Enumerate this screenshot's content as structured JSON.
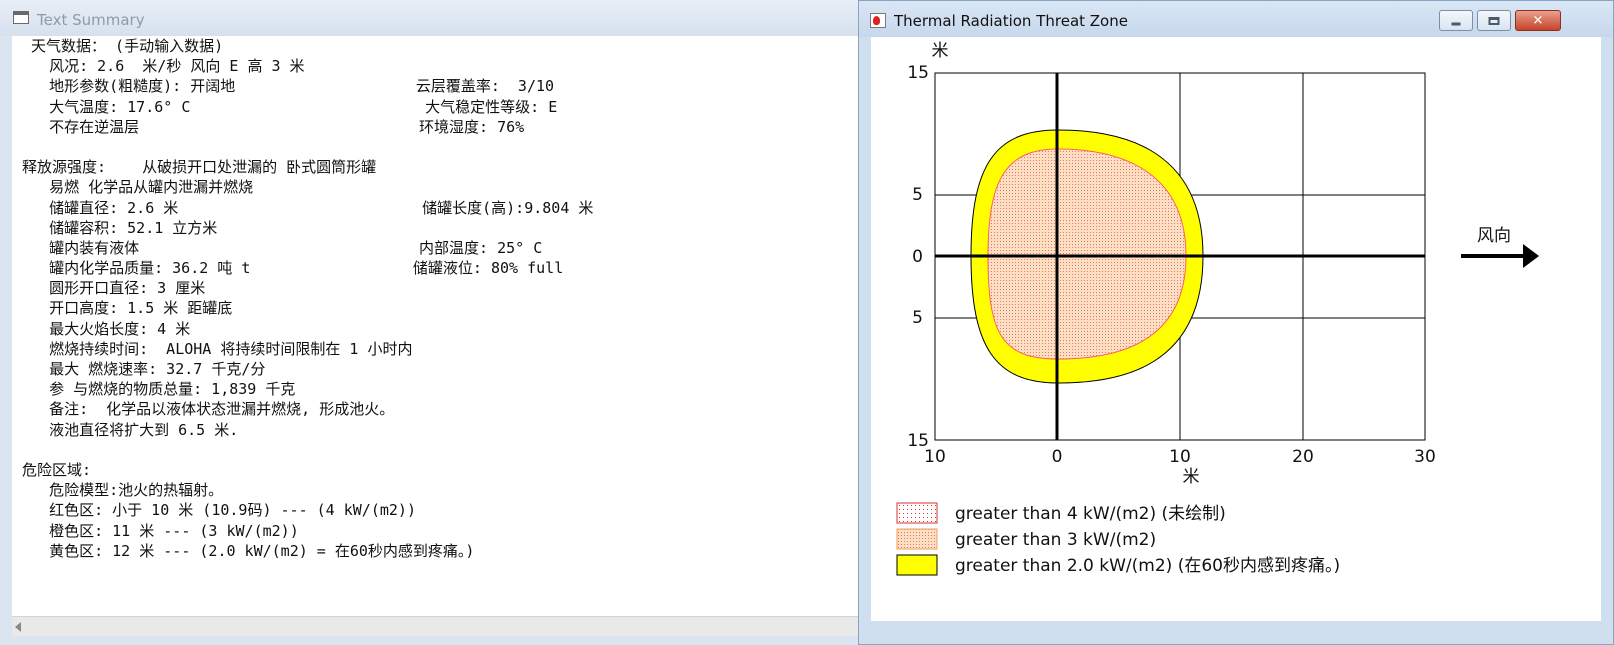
{
  "left_window": {
    "title": "Text Summary",
    "lines": [
      " 天气数据： (手动输入数据)",
      "   风况: 2.6  米/秒 风向 E 高 3 米",
      "   地形参数(粗糙度): 开阔地                    云层覆盖率:  3/10",
      "   大气温度: 17.6° C                          大气稳定性等级: E",
      "   不存在逆温层                               环境湿度: 76%",
      "",
      "释放源强度:    从破损开口处泄漏的 卧式圆筒形罐",
      "   易燃 化学品从罐内泄漏并燃烧",
      "   储罐直径: 2.6 米                           储罐长度(高):9.804 米",
      "   储罐容积: 52.1 立方米",
      "   罐内装有液体                               内部温度: 25° C",
      "   罐内化学品质量: 36.2 吨 t                  储罐液位: 80% full",
      "   圆形开口直径: 3 厘米",
      "   开口高度: 1.5 米 距罐底",
      "   最大火焰长度: 4 米",
      "   燃烧持续时间:  ALOHA 将持续时间限制在 1 小时内",
      "   最大 燃烧速率: 32.7 千克/分",
      "   参 与燃烧的物质总量: 1,839 千克",
      "   备注:  化学品以液体状态泄漏并燃烧, 形成池火。",
      "   液池直径将扩大到 6.5 米.",
      "",
      "危险区域:",
      "   危险模型:池火的热辐射。",
      "   红色区: 小于 10 米 (10.9码) --- (4 kW/(m2))",
      "   橙色区: 11 米 --- (3 kW/(m2))",
      "   黄色区: 12 米 --- (2.0 kW/(m2) = 在60秒内感到疼痛。)"
    ]
  },
  "right_window": {
    "title": "Thermal Radiation Threat Zone",
    "controls": {
      "close_glyph": "✕"
    },
    "plot": {
      "y_unit": "米",
      "x_unit": "米",
      "x_ticks": [
        "10",
        "0",
        "10",
        "20",
        "30"
      ],
      "y_ticks": [
        "15",
        "5",
        "0",
        "5",
        "15"
      ],
      "wind_label": "风向",
      "legend": [
        {
          "label": "greater than 4 kW/(m2) (未绘制)",
          "color": "#ff0000"
        },
        {
          "label": "greater than 3 kW/(m2)",
          "color": "#fbe0c2"
        },
        {
          "label": "greater than 2.0 kW/(m2) (在60秒内感到疼痛。)",
          "color": "#ffff00"
        }
      ]
    }
  }
}
